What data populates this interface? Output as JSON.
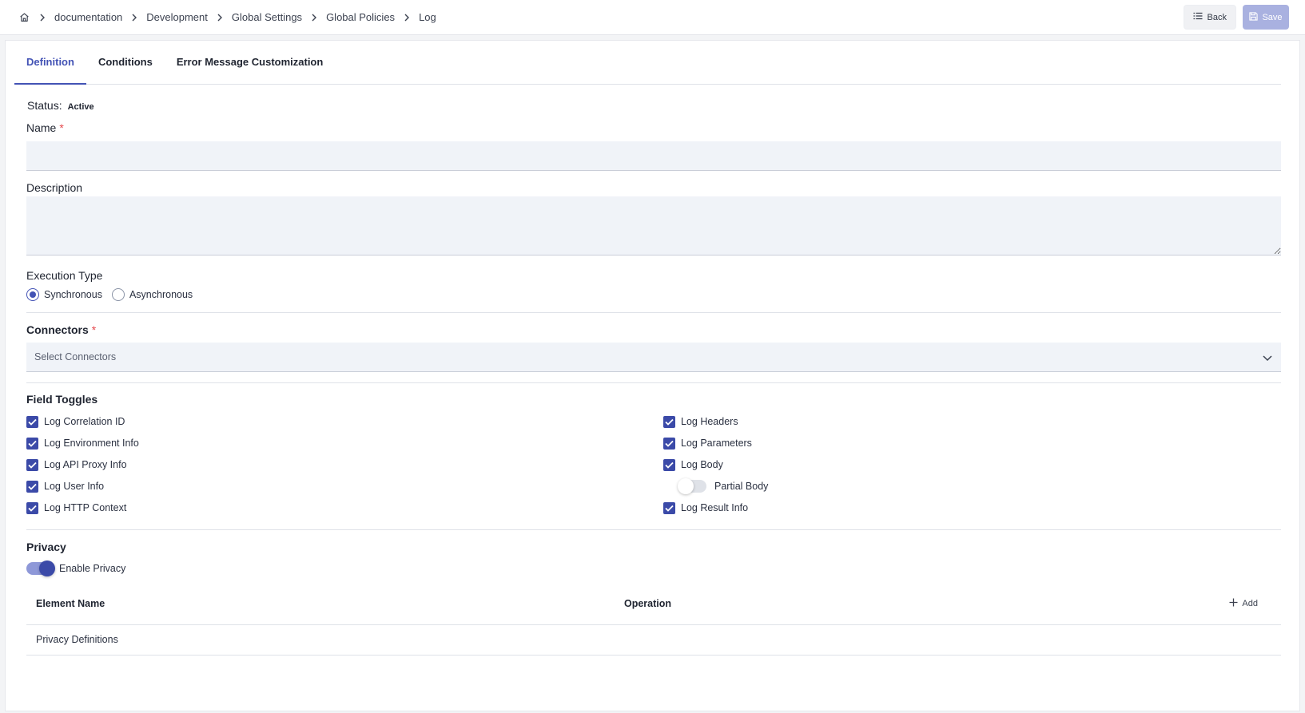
{
  "breadcrumb": {
    "items": [
      "documentation",
      "Development",
      "Global Settings",
      "Global Policies",
      "Log"
    ]
  },
  "toolbar": {
    "back_label": "Back",
    "save_label": "Save"
  },
  "tabs": [
    {
      "label": "Definition",
      "active": true
    },
    {
      "label": "Conditions",
      "active": false
    },
    {
      "label": "Error Message Customization",
      "active": false
    }
  ],
  "form": {
    "status_label": "Status:",
    "status_value": "Active",
    "name_label": "Name",
    "name_required": "*",
    "name_value": "",
    "description_label": "Description",
    "description_value": "",
    "execution_type_label": "Execution Type",
    "execution_options": [
      {
        "label": "Synchronous",
        "selected": true
      },
      {
        "label": "Asynchronous",
        "selected": false
      }
    ],
    "connectors_label": "Connectors",
    "connectors_required": "*",
    "connectors_placeholder": "Select Connectors"
  },
  "field_toggles": {
    "heading": "Field Toggles",
    "left": [
      {
        "label": "Log Correlation ID",
        "checked": true
      },
      {
        "label": "Log Environment Info",
        "checked": true
      },
      {
        "label": "Log API Proxy Info",
        "checked": true
      },
      {
        "label": "Log User Info",
        "checked": true
      },
      {
        "label": "Log HTTP Context",
        "checked": true
      }
    ],
    "right": [
      {
        "label": "Log Headers",
        "checked": true
      },
      {
        "label": "Log Parameters",
        "checked": true
      },
      {
        "label": "Log Body",
        "checked": true
      },
      {
        "label": "Log Result Info",
        "checked": true
      }
    ],
    "partial_body_label": "Partial Body",
    "partial_body_on": false
  },
  "privacy": {
    "heading": "Privacy",
    "enable_label": "Enable Privacy",
    "enabled": true,
    "table": {
      "col_element": "Element Name",
      "col_operation": "Operation",
      "add_label": "Add",
      "rows": [
        {
          "element": "Privacy Definitions"
        }
      ]
    }
  },
  "colors": {
    "accent": "#4353b5",
    "checkbox": "#3b4aa8",
    "input_bg": "#f0f3f8",
    "required": "#e5484d"
  }
}
